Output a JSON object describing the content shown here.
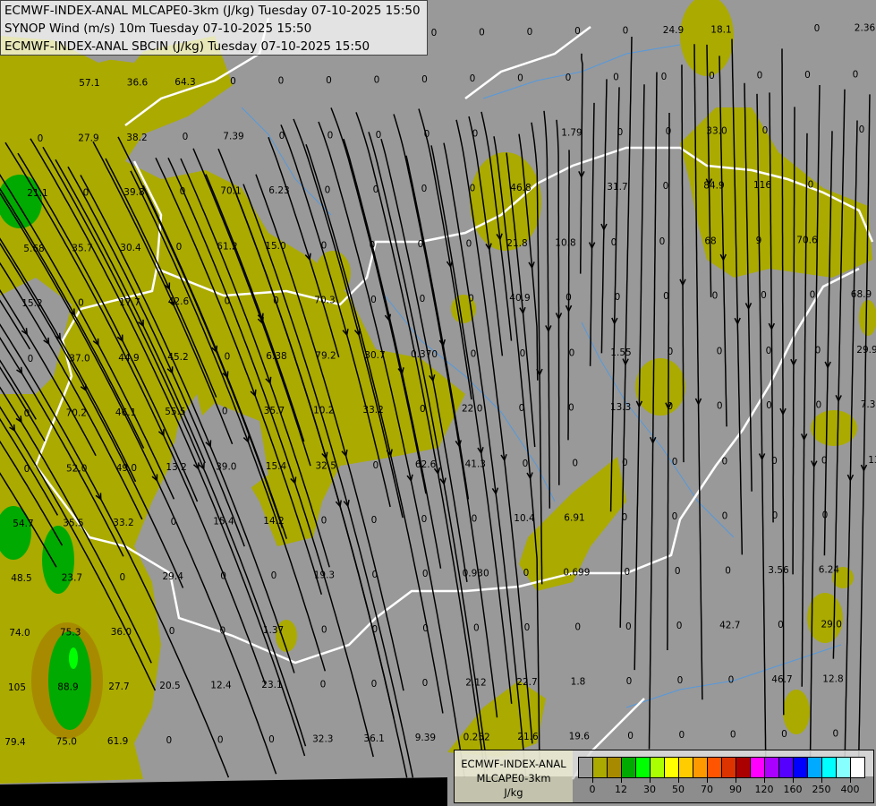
{
  "title_lines": [
    "ECMWF-INDEX-ANAL MLCAPE0-3km (J/kg) Tuesday 07-10-2025 15:50",
    "SYNOP Wind (m/s) 10m Tuesday 07-10-2025 15:50",
    "ECMWF-INDEX-ANAL SBCIN (J/kg) Tuesday 07-10-2025 15:50"
  ],
  "legend": {
    "source": "ECMWF-INDEX-ANAL",
    "parameter": "MLCAPE0-3km",
    "unit": "J/kg",
    "colors": [
      "#999999",
      "#aaaa00",
      "#a88a00",
      "#00aa00",
      "#00ff00",
      "#aaff00",
      "#ffff00",
      "#ffcc00",
      "#ff9900",
      "#ff5500",
      "#dd3300",
      "#aa0000",
      "#ff00ff",
      "#aa00ff",
      "#5500ff",
      "#0000ff",
      "#00aaff",
      "#00ffff",
      "#88ffff",
      "#ffffff"
    ],
    "ticks": [
      "0",
      "12",
      "30",
      "50",
      "70",
      "90",
      "120",
      "160",
      "250",
      "400"
    ]
  },
  "map_colors": {
    "background": "#999999",
    "low_cape": "#aaaa00",
    "mid_cape": "#a88a00",
    "high_cape": "#00aa00",
    "border": "#ffffff",
    "river": "#5599dd",
    "streamline": "#000000"
  },
  "station_values": [
    [
      "0",
      "0",
      "0",
      "0",
      "0",
      "24.9",
      "18.1",
      "",
      "0",
      "2.36"
    ],
    [
      "57.1",
      "36.6",
      "64.3",
      "0",
      "0",
      "0",
      "0",
      "0",
      "0",
      "0",
      "0",
      "0",
      "0",
      "0",
      "0",
      "0",
      "0"
    ],
    [
      "0",
      "27.9",
      "38.2",
      "0",
      "7.39",
      "0",
      "0",
      "0",
      "0",
      "0",
      "",
      "1.79",
      "0",
      "0",
      "33.0",
      "0",
      "",
      "0"
    ],
    [
      "21.1",
      "0",
      "39.8",
      "0",
      "70.1",
      "6.23",
      "0",
      "0",
      "0",
      "0",
      "46.8",
      "",
      "31.7",
      "0",
      "84.9",
      "116",
      "0"
    ],
    [
      "5.68",
      "35.7",
      "30.4",
      "0",
      "61.2",
      "15.0",
      "0",
      "0",
      "0",
      "0",
      "21.8",
      "10.8",
      "0",
      "0",
      "68",
      "9",
      "70.6"
    ],
    [
      "15.2",
      "0",
      "17.7",
      "42.6",
      "0",
      "0",
      "70.3",
      "0",
      "0",
      "0",
      "40.9",
      "0",
      "0",
      "0",
      "0",
      "0",
      "0",
      "68.9"
    ],
    [
      "0",
      "37.0",
      "44.9",
      "45.2",
      "0",
      "6.38",
      "79.2",
      "30.7",
      "0.370",
      "0",
      "0",
      "0",
      "1.55",
      "0",
      "0",
      "0",
      "0",
      "29.9"
    ],
    [
      "0",
      "70.2",
      "46.1",
      "55.5",
      "0",
      "35.7",
      "10.2",
      "33.2",
      "0",
      "22.0",
      "0",
      "0",
      "13.3",
      "0",
      "0",
      "0",
      "0",
      "7.3"
    ],
    [
      "0",
      "52.0",
      "49.0",
      "13.2",
      "39.0",
      "15.4",
      "32.5",
      "0",
      "62.6",
      "41.3",
      "0",
      "0",
      "0",
      "0",
      "0",
      "0",
      "0",
      "13"
    ],
    [
      "54.7",
      "35.5",
      "33.2",
      "0",
      "15.4",
      "14.2",
      "0",
      "0",
      "0",
      "0",
      "10.4",
      "6.91",
      "0",
      "0",
      "0",
      "0",
      "0"
    ],
    [
      "48.5",
      "23.7",
      "0",
      "29.4",
      "0",
      "0",
      "19.3",
      "0",
      "0",
      "0.930",
      "0",
      "0.699",
      "0",
      "0",
      "0",
      "3.56",
      "6.24"
    ],
    [
      "74.0",
      "75.3",
      "36.0",
      "0",
      "0",
      "1.37",
      "0",
      "0",
      "0",
      "0",
      "0",
      "0",
      "0",
      "0",
      "42.7",
      "0",
      "29.0"
    ],
    [
      "105",
      "88.9",
      "27.7",
      "20.5",
      "12.4",
      "23.1",
      "0",
      "0",
      "0",
      "2.12",
      "22.7",
      "1.8",
      "0",
      "0",
      "0",
      "46.7",
      "12.8"
    ],
    [
      "79.4",
      "75.0",
      "61.9",
      "0",
      "0",
      "0",
      "32.3",
      "36.1",
      "9.39",
      "0.252",
      "21.6",
      "19.6",
      "0",
      "0",
      "0",
      "0",
      "0"
    ]
  ]
}
